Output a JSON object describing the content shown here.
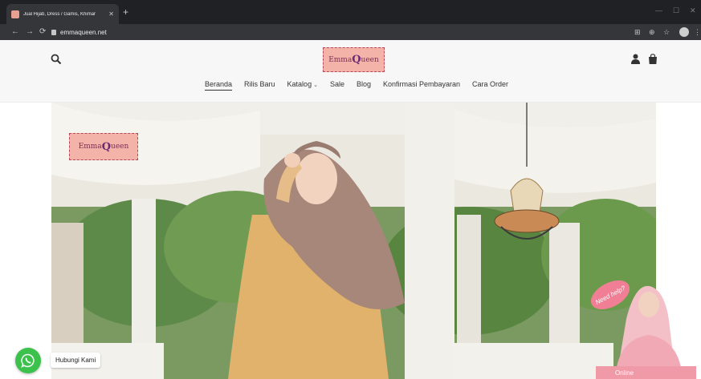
{
  "browser": {
    "tab_title": "Jual Hijab, Dress / Gamis, Khimar",
    "url": "emmaqueen.net",
    "icons": [
      "back-icon",
      "forward-icon",
      "reload-icon",
      "lock-icon",
      "translate-icon",
      "zoom-icon",
      "star-icon",
      "profile-icon",
      "menu-icon"
    ]
  },
  "header": {
    "logo_text": "Emma",
    "logo_text_end": "ueen",
    "nav": [
      {
        "label": "Beranda",
        "active": true
      },
      {
        "label": "Rilis Baru"
      },
      {
        "label": "Katalog",
        "has_dropdown": true
      },
      {
        "label": "Sale"
      },
      {
        "label": "Blog"
      },
      {
        "label": "Konfirmasi Pembayaran"
      },
      {
        "label": "Cara Order"
      }
    ]
  },
  "hero": {
    "logo_text": "Emma",
    "logo_text_end": "ueen"
  },
  "widgets": {
    "whatsapp_label": "Hubungi Kami",
    "help_bubble": "Need help?",
    "online_label": "Online"
  },
  "colors": {
    "brand_pink": "#f4b3a9",
    "whatsapp_green": "#3cc24c",
    "online_pink": "#f09aa8"
  }
}
